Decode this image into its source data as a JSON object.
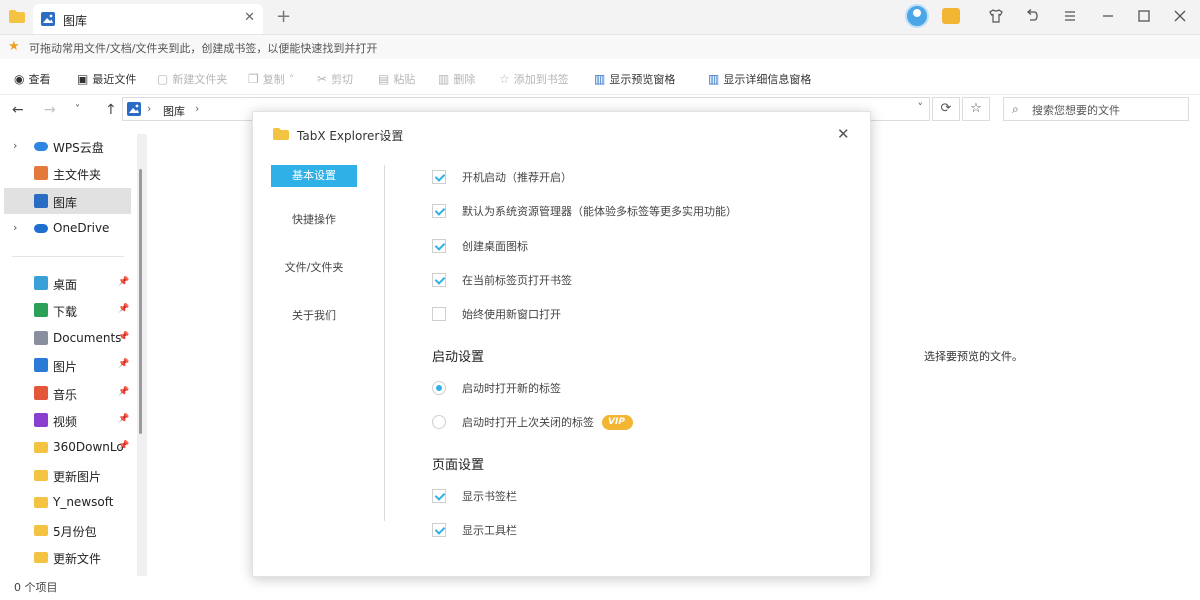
{
  "window": {
    "tab_title": "图库",
    "new_tab_symbol": "+",
    "close_symbol": "✕",
    "controls": [
      "undo",
      "menu",
      "minimize",
      "maximize",
      "close"
    ]
  },
  "hint": {
    "text": "可拖动常用文件/文档/文件夹到此，创建成书签，以便能快速找到并打开"
  },
  "toolbar": {
    "view": "查看",
    "recent": "最近文件",
    "new_folder": "新建文件夹",
    "copy": "复制",
    "cut": "剪切",
    "paste": "粘贴",
    "delete": "删除",
    "add_bookmark": "添加到书签",
    "show_preview": "显示预览窗格",
    "show_details": "显示详细信息窗格"
  },
  "address": {
    "crumb": "图库",
    "search_placeholder": "搜索您想要的文件"
  },
  "sidebar": {
    "top": [
      {
        "label": "WPS云盘",
        "icon": "cloud-icon",
        "color": "#2f86e0",
        "chevron": true
      },
      {
        "label": "主文件夹",
        "icon": "home-icon",
        "color": "#e3793a",
        "chevron": false
      },
      {
        "label": "图库",
        "icon": "gallery-icon",
        "color": "#2b6cc4",
        "chevron": false,
        "active": true
      },
      {
        "label": "OneDrive",
        "icon": "onedrive-icon",
        "color": "#1f6fd1",
        "chevron": true
      }
    ],
    "pinned": [
      {
        "label": "桌面",
        "icon": "desktop-icon",
        "color": "#3aa0d8",
        "pinned": true
      },
      {
        "label": "下载",
        "icon": "download-icon",
        "color": "#2aa058",
        "pinned": true
      },
      {
        "label": "Documents",
        "icon": "documents-icon",
        "color": "#8a8fa0",
        "pinned": true
      },
      {
        "label": "图片",
        "icon": "pictures-icon",
        "color": "#2b7bd6",
        "pinned": true
      },
      {
        "label": "音乐",
        "icon": "music-icon",
        "color": "#e4563a",
        "pinned": true
      },
      {
        "label": "视频",
        "icon": "video-icon",
        "color": "#8b3fd1",
        "pinned": true
      },
      {
        "label": "360DownLo",
        "icon": "folder-icon",
        "color": "#f5c342",
        "pinned": true
      },
      {
        "label": "更新图片",
        "icon": "folder-icon",
        "color": "#f5c342",
        "pinned": false
      },
      {
        "label": "Y_newsoft",
        "icon": "folder-icon",
        "color": "#f5c342",
        "pinned": false
      },
      {
        "label": "5月份包",
        "icon": "folder-icon",
        "color": "#f5c342",
        "pinned": false
      },
      {
        "label": "更新文件",
        "icon": "folder-icon",
        "color": "#f5c342",
        "pinned": false
      }
    ]
  },
  "status": {
    "items": "0 个项目"
  },
  "preview": {
    "message": "选择要预览的文件。"
  },
  "dialog": {
    "title": "TabX Explorer设置",
    "nav": [
      "基本设置",
      "快捷操作",
      "文件/文件夹",
      "关于我们"
    ],
    "active_nav": "基本设置",
    "general": [
      {
        "label": "开机启动（推荐开启）",
        "checked": true
      },
      {
        "label": "默认为系统资源管理器（能体验多标签等更多实用功能）",
        "checked": true
      },
      {
        "label": "创建桌面图标",
        "checked": true
      },
      {
        "label": "在当前标签页打开书签",
        "checked": true
      },
      {
        "label": "始终使用新窗口打开",
        "checked": false
      }
    ],
    "startup_title": "启动设置",
    "startup": [
      {
        "label": "启动时打开新的标签",
        "selected": true
      },
      {
        "label": "启动时打开上次关闭的标签",
        "selected": false,
        "badge": "VIP"
      }
    ],
    "page_title": "页面设置",
    "page": [
      {
        "label": "显示书签栏",
        "checked": true
      },
      {
        "label": "显示工具栏",
        "checked": true
      }
    ],
    "accent_color": "#2fb1e8",
    "vip_color": "#f2b632"
  }
}
